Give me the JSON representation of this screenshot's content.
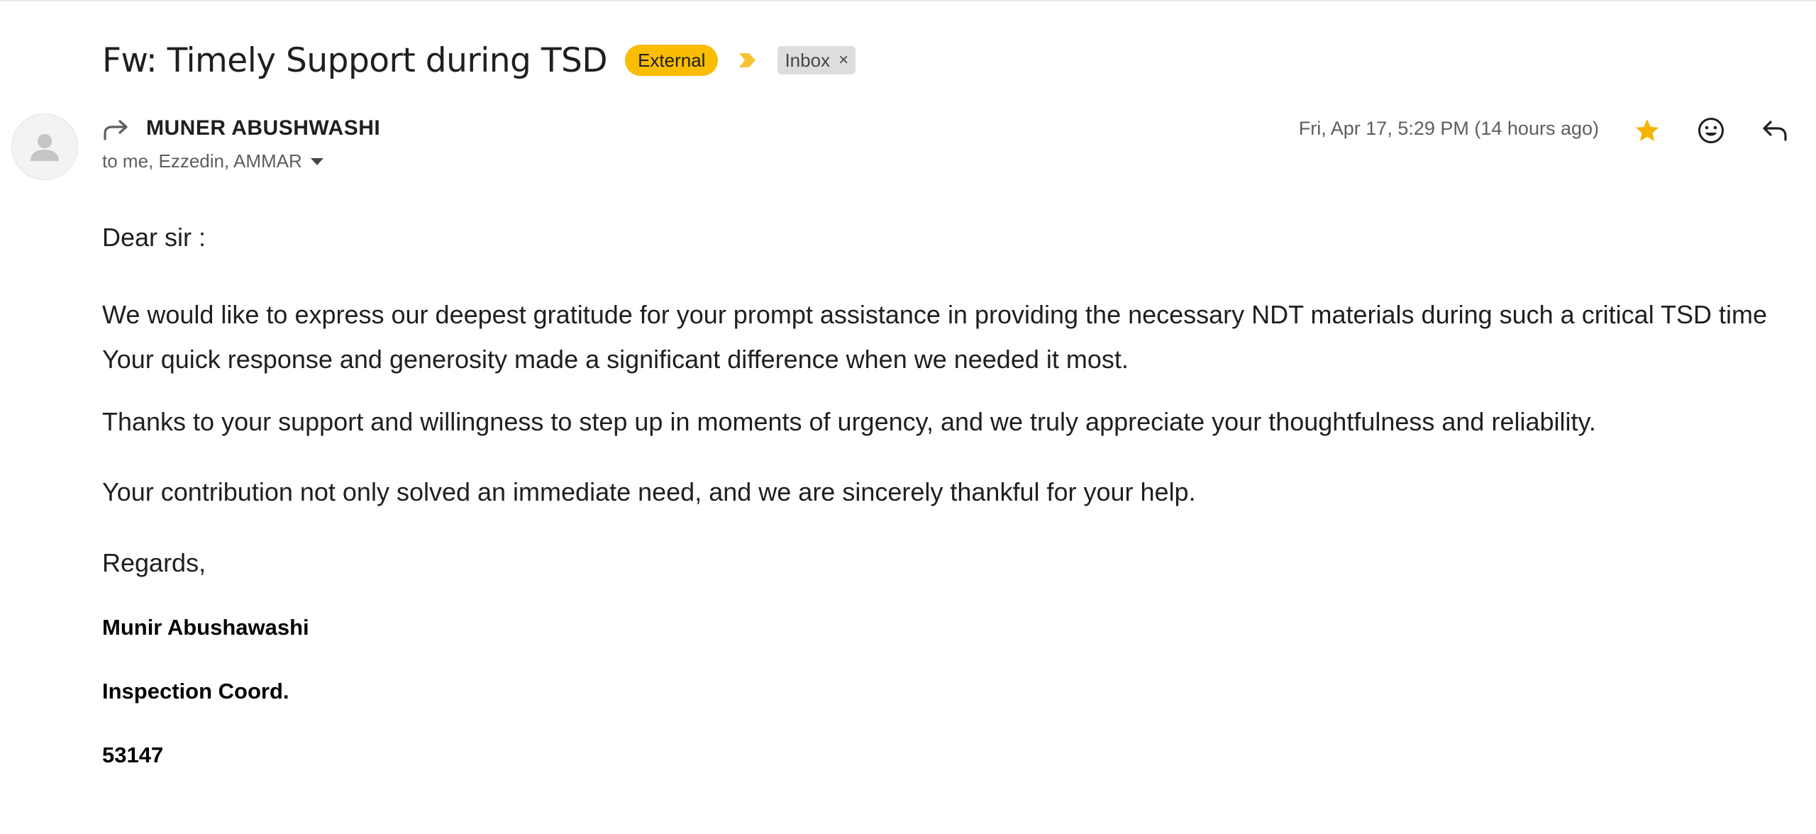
{
  "email": {
    "subject": "Fw: Timely Support during TSD",
    "labels": {
      "external": "External",
      "inbox": "Inbox",
      "inbox_remove": "×"
    },
    "sender": {
      "name": "MUNER ABUSHWASHI",
      "recipients": "to me, Ezzedin, AMMAR"
    },
    "timestamp": "Fri, Apr 17, 5:29 PM (14 hours ago)",
    "body": {
      "greeting": "Dear sir :",
      "paragraph1": "We would like to express our deepest gratitude for your prompt assistance in providing the necessary NDT materials during such a critical TSD time Your quick response and generosity made a significant difference when we needed it most.",
      "paragraph2": "Thanks to your support and willingness to step up in moments of urgency, and we truly appreciate your thoughtfulness and reliability.",
      "paragraph3": "Your contribution not only solved an immediate need, and we are sincerely thankful for your help.",
      "regards": "Regards,"
    },
    "signature": {
      "name": "Munir Abushawashi",
      "title": "Inspection Coord.",
      "extension": "53147"
    }
  },
  "icons": {
    "importance": "importance-marker-icon",
    "avatar": "default-avatar-icon",
    "forward": "forward-arrow-icon",
    "star": "star-icon",
    "emoji": "emoji-reaction-icon",
    "reply": "reply-icon",
    "recipient_details": "chevron-down-icon"
  },
  "colors": {
    "external_badge": "#fbbc04",
    "importance": "#f8c235",
    "star": "#f4b400",
    "inbox_label_bg": "#dddddd",
    "text_primary": "#1f1f1f",
    "text_secondary": "#5e5e5e"
  }
}
